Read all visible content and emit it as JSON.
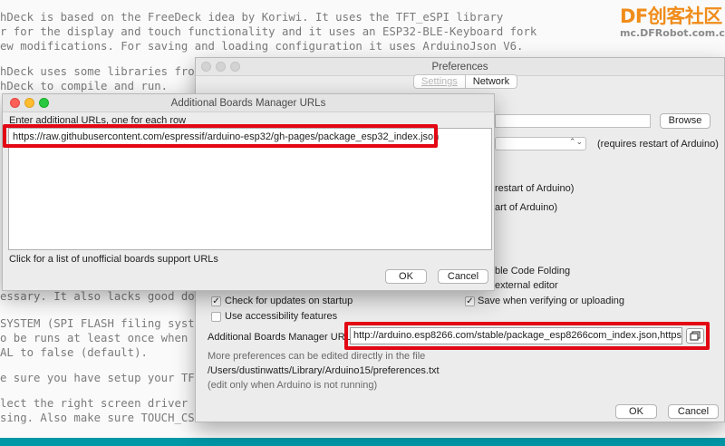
{
  "background": {
    "lines": [
      "hDeck is based on the FreeDeck idea by Koriwi. It uses the TFT_eSPI library",
      "r for the display and touch functionality and it uses an ESP32-BLE-Keyboard fork",
      "ew modifications. For saving and loading configuration it uses ArduinoJson V6.",
      "",
      "hDeck uses some libraries from ot",
      "hDeck to compile and run.",
      "essary. It also lacks good docume",
      "SYSTEM (SPI FLASH filing system)",
      "o be runs at least once when usin",
      "AL to false (default).",
      "e sure you have setup your TFT dis",
      "lect the right screen driver and",
      "sing. Also make sure TOUCH_CS is d"
    ]
  },
  "logo": {
    "brand": "DF",
    "brand_cn": "创客社区",
    "domain": "mc.DFRobot.com.cn"
  },
  "preferences": {
    "title": "Preferences",
    "tabs": [
      "Settings",
      "Network"
    ],
    "browse_label": "Browse",
    "restart_note": "(requires restart of Arduino)",
    "partial_restart_1": "restart of Arduino)",
    "partial_restart_2": "art of Arduino)",
    "partial_code_folding": "ble Code Folding",
    "partial_external_editor": "external editor",
    "check_updates_label": "Check for updates on startup",
    "save_verify_label": "Save when verifying or uploading",
    "accessibility_label": "Use accessibility features",
    "boards_url_label": "Additional Boards Manager URLs:",
    "boards_url_value": "http://arduino.esp8266.com/stable/package_esp8266com_index.json,https:/",
    "more_prefs_text": "More preferences can be edited directly in the file",
    "prefs_path": "/Users/dustinwatts/Library/Arduino15/preferences.txt",
    "edit_note": "(edit only when Arduino is not running)",
    "ok_label": "OK",
    "cancel_label": "Cancel"
  },
  "boards_dialog": {
    "title": "Additional Boards Manager URLs",
    "instruction": "Enter additional URLs, one for each row",
    "url_row": "https://raw.githubusercontent.com/espressif/arduino-esp32/gh-pages/package_esp32_index.json",
    "help_link": "Click for a list of unofficial boards support URLs",
    "ok_label": "OK",
    "cancel_label": "Cancel"
  },
  "colors": {
    "highlight": "#e30613",
    "accent_bar": "#0097a7"
  }
}
